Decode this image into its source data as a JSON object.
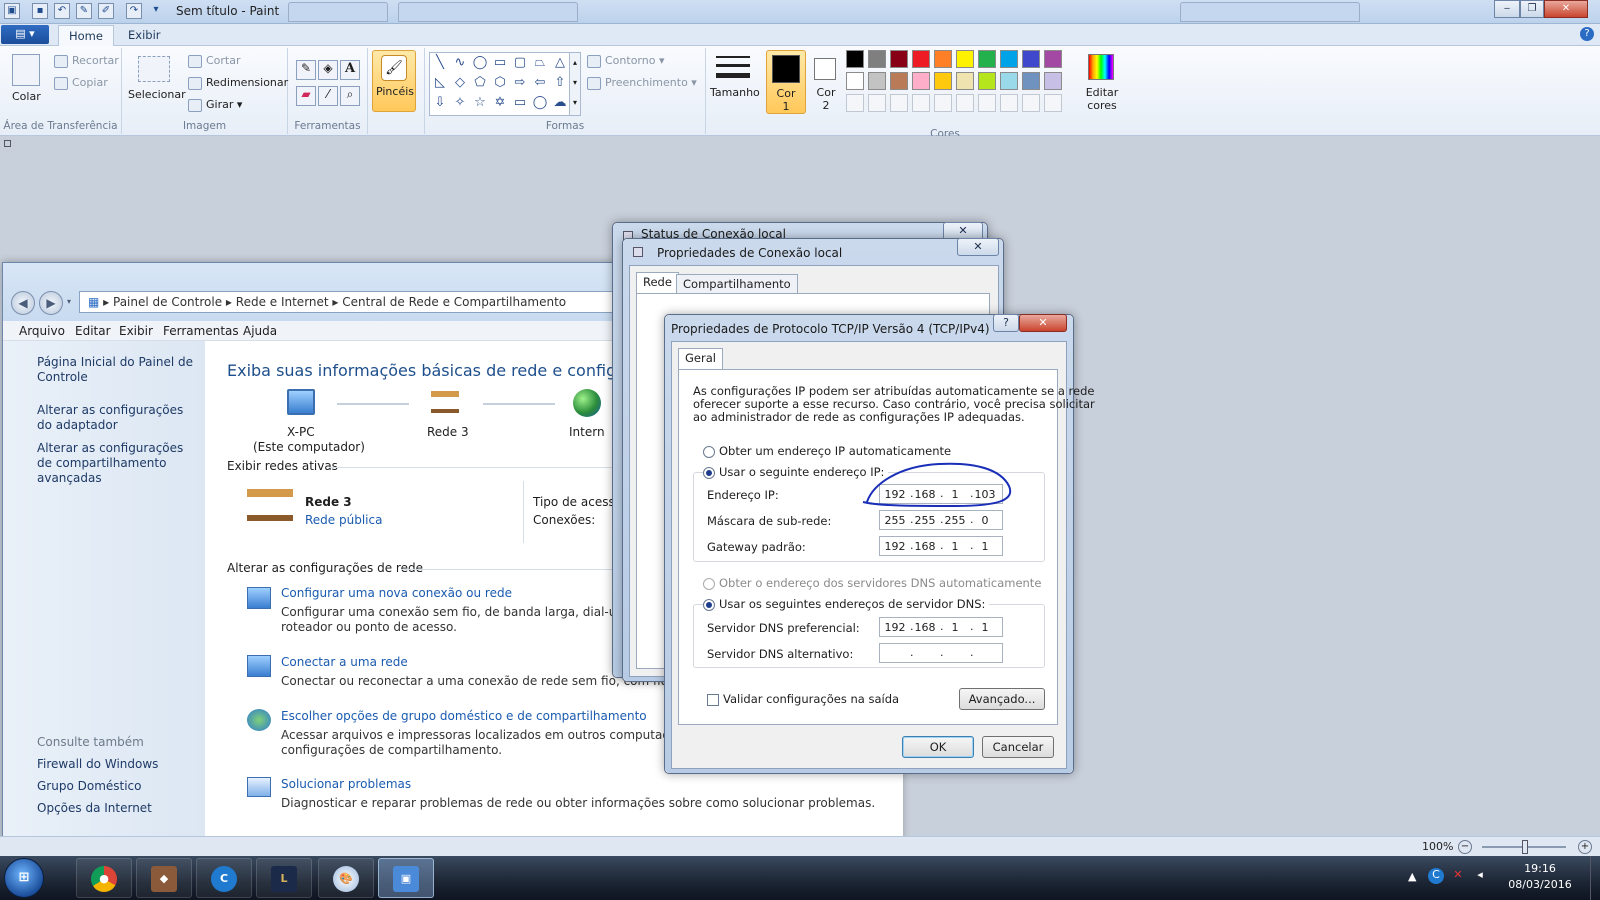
{
  "paint": {
    "title": "Sem título - Paint",
    "tabs": {
      "home": "Home",
      "view": "Exibir"
    },
    "groups": {
      "clipboard": "Área de Transferência",
      "image": "Imagem",
      "tools": "Ferramentas",
      "shapes": "Formas",
      "colors": "Cores"
    },
    "buttons": {
      "paste": "Colar",
      "cut": "Recortar",
      "copy": "Copiar",
      "select": "Selecionar",
      "crop": "Cortar",
      "resize": "Redimensionar",
      "rotate": "Girar ▾",
      "brushes": "Pincéis",
      "outline": "Contorno ▾",
      "fill": "Preenchimento ▾",
      "size": "Tamanho",
      "color1_line1": "Cor",
      "color1_line2": "1",
      "color2_line1": "Cor",
      "color2_line2": "2",
      "edit_colors_line1": "Editar",
      "edit_colors_line2": "cores"
    },
    "colors_row1": [
      "#000000",
      "#7f7f7f",
      "#880015",
      "#ed1c24",
      "#ff7f27",
      "#fff200",
      "#22b14c",
      "#00a2e8",
      "#3f48cc",
      "#a349a4"
    ],
    "colors_row2": [
      "#ffffff",
      "#c3c3c3",
      "#b97a57",
      "#ffaec9",
      "#ffc90e",
      "#efe4b0",
      "#b5e61d",
      "#99d9ea",
      "#7092be",
      "#c8bfe7"
    ],
    "zoom": "100%"
  },
  "control_panel": {
    "breadcrumb": {
      "root": "Painel de Controle",
      "level1": "Rede e Internet",
      "level2": "Central de Rede e Compartilhamento"
    },
    "menu": {
      "file": "Arquivo",
      "edit": "Editar",
      "view": "Exibir",
      "tools": "Ferramentas",
      "help": "Ajuda"
    },
    "sidebar": {
      "home": "Página Inicial do Painel de Controle",
      "adapter": "Alterar as configurações do adaptador",
      "sharing": "Alterar as configurações de compartilhamento avançadas",
      "see_also": "Consulte também",
      "firewall": "Firewall do Windows",
      "homegroup": "Grupo Doméstico",
      "internet_options": "Opções da Internet"
    },
    "main": {
      "title": "Exiba suas informações básicas de rede e configure as c",
      "pc_name": "X-PC",
      "pc_sub": "(Este computador)",
      "network_name": "Rede 3",
      "internet": "Intern",
      "active_networks": "Exibir redes ativas",
      "active_name": "Rede 3",
      "active_type": "Rede pública",
      "access_type": "Tipo de acess",
      "connections": "Conexões:",
      "change_settings": "Alterar as configurações de rede",
      "task1_link": "Configurar uma nova conexão ou rede",
      "task1_desc1": "Configurar uma conexão sem fio, de banda larga, dial-up, ad h",
      "task1_desc2": "roteador ou ponto de acesso.",
      "task2_link": "Conectar a uma rede",
      "task2_desc1": "Conectar ou reconectar a uma conexão de rede sem fio, com fio, dial-u",
      "task3_link": "Escolher opções de grupo doméstico e de compartilhamento",
      "task3_desc1": "Acessar arquivos e impressoras localizados em outros computadores da",
      "task3_desc2": "configurações de compartilhamento.",
      "task4_link": "Solucionar problemas",
      "task4_desc1": "Diagnosticar e reparar problemas de rede ou obter informações sobre como solucionar problemas."
    }
  },
  "status_dialog": {
    "title": "Status de Conexão local"
  },
  "props_dialog": {
    "title": "Propriedades de Conexão local",
    "tab_network": "Rede",
    "tab_sharing": "Compartilhamento"
  },
  "tcp_dialog": {
    "title": "Propriedades de Protocolo TCP/IP Versão 4 (TCP/IPv4)",
    "help": "?",
    "tab_general": "Geral",
    "intro1": "As configurações IP podem ser atribuídas automaticamente se a rede",
    "intro2": "oferecer suporte a esse recurso. Caso contrário, você precisa solicitar",
    "intro3": "ao administrador de rede as configurações IP adequadas.",
    "auto_ip": "Obter um endereço IP automaticamente",
    "manual_ip": "Usar o seguinte endereço IP:",
    "ip_label": "Endereço IP:",
    "ip": [
      "192",
      "168",
      "1",
      "103"
    ],
    "mask_label": "Máscara de sub-rede:",
    "mask": [
      "255",
      "255",
      "255",
      "0"
    ],
    "gateway_label": "Gateway padrão:",
    "gateway": [
      "192",
      "168",
      "1",
      "1"
    ],
    "auto_dns": "Obter o endereço dos servidores DNS automaticamente",
    "manual_dns": "Usar os seguintes endereços de servidor DNS:",
    "dns1_label": "Servidor DNS preferencial:",
    "dns1": [
      "192",
      "168",
      "1",
      "1"
    ],
    "dns2_label": "Servidor DNS alternativo:",
    "validate": "Validar configurações na saída",
    "advanced": "Avançado...",
    "ok": "OK",
    "cancel": "Cancelar"
  },
  "taskbar": {
    "start": "⊞",
    "apps": [
      "chrome",
      "game",
      "cc",
      "lol",
      "paint",
      "network"
    ],
    "time": "19:16",
    "date": "08/03/2016"
  },
  "icons": {
    "paste": "clipboard-icon",
    "brush": "brush-icon",
    "pc": "computer-icon",
    "bench": "bench-icon",
    "globe": "globe-icon"
  }
}
